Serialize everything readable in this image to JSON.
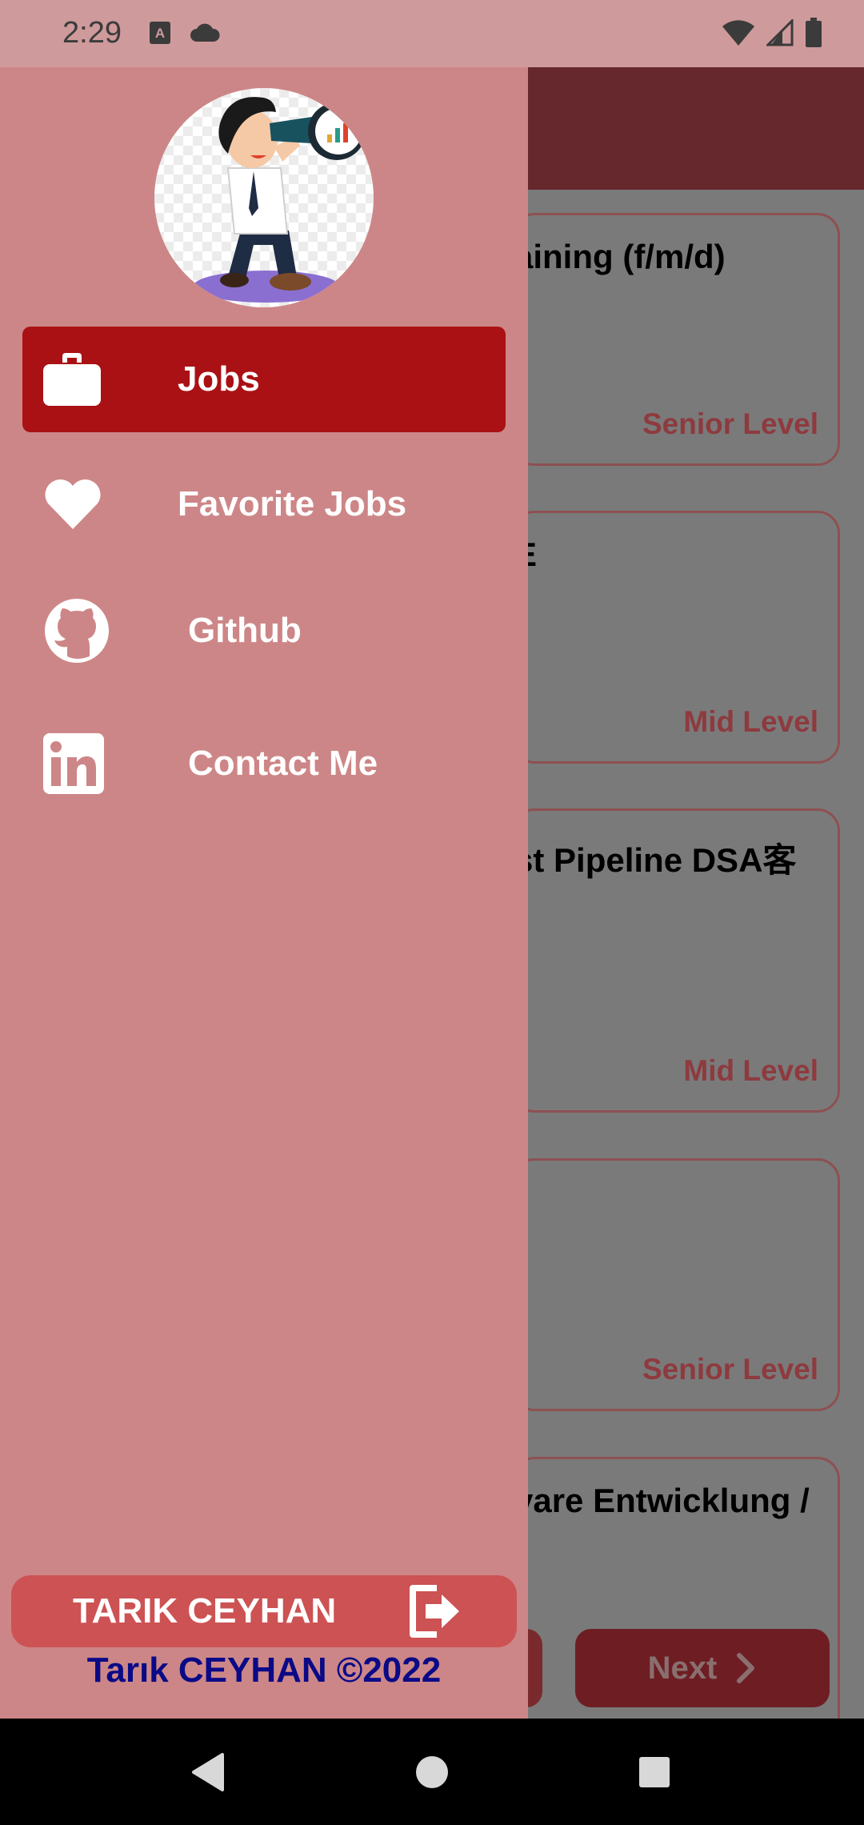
{
  "status_bar": {
    "time": "2:29",
    "icons_left": [
      "text-format-icon",
      "cloud-icon"
    ],
    "icons_right": [
      "wifi-icon",
      "cell-signal-icon",
      "battery-icon"
    ]
  },
  "jobs": [
    {
      "title": "aining (f/m/d)",
      "level": "Senior Level"
    },
    {
      "title": "E",
      "level": "Mid Level"
    },
    {
      "title": "st Pipeline DSA客",
      "level": "Mid Level"
    },
    {
      "title": "",
      "level": "Senior Level"
    },
    {
      "title": "vare Entwicklung /",
      "level": ""
    }
  ],
  "pagination": {
    "next_label": "Next"
  },
  "drawer": {
    "menu": [
      {
        "label": "Jobs",
        "icon": "briefcase-icon",
        "active": true
      },
      {
        "label": "Favorite Jobs",
        "icon": "heart-icon",
        "active": false
      },
      {
        "label": "Github",
        "icon": "github-icon",
        "active": false
      },
      {
        "label": "Contact Me",
        "icon": "linkedin-icon",
        "active": false
      }
    ],
    "user_name": "TARIK CEYHAN",
    "copyright": "Tarık CEYHAN ©2022"
  },
  "colors": {
    "drawer_bg": "#cd8687",
    "active_item": "#aa1114",
    "user_box": "#cd5253",
    "copyright_text": "#0a0a87",
    "app_bar": "#66282c",
    "level_text": "#8e3a3e"
  }
}
